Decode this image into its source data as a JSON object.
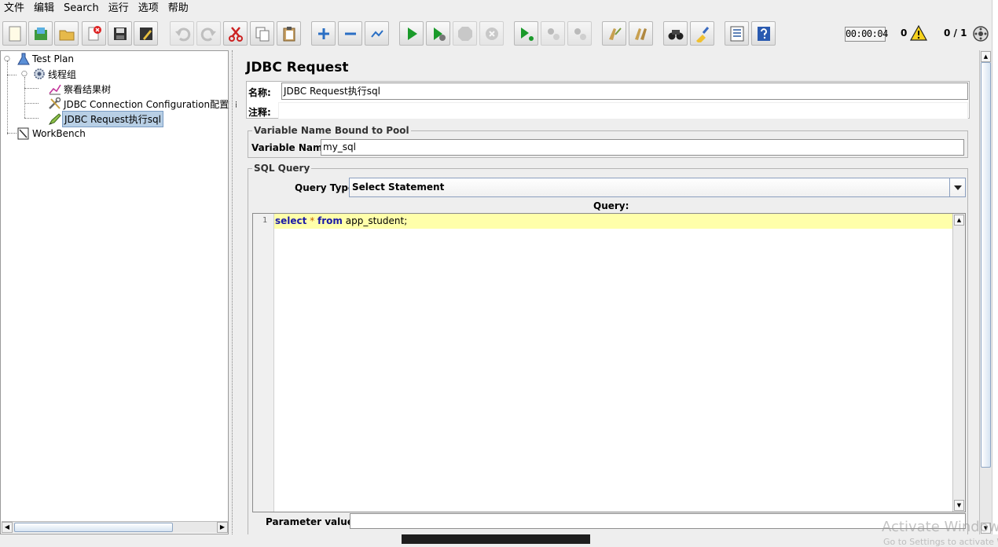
{
  "menu": [
    "文件",
    "编辑",
    "Search",
    "运行",
    "选项",
    "帮助"
  ],
  "toolbar": {
    "icons": [
      "new-icon",
      "templates-icon",
      "open-icon",
      "close-icon",
      "save-icon",
      "save-as-icon",
      "undo-icon",
      "redo-icon",
      "cut-icon",
      "copy-icon",
      "paste-icon",
      "expand-icon",
      "collapse-icon",
      "toggle-icon",
      "start-icon",
      "start-no-pause-icon",
      "stop-icon",
      "shutdown-icon",
      "remote-start-icon",
      "remote-stop-icon",
      "remote-shutdown-icon",
      "clear-icon",
      "clear-all-icon",
      "search-icon",
      "reset-search-icon",
      "function-helper-icon",
      "help-icon"
    ],
    "timer": "00:00:04",
    "warning_count": "0",
    "threads": "0 / 1"
  },
  "tree": {
    "test_plan": "Test Plan",
    "thread_group": "线程组",
    "listener": "察看结果树",
    "jdbc_config": "JDBC Connection Configuration配置数",
    "jdbc_request": "JDBC Request执行sql",
    "workbench": "WorkBench"
  },
  "panel": {
    "title": "JDBC Request",
    "name_label": "名称:",
    "name_value": "JDBC Request执行sql",
    "comment_label": "注释:",
    "comment_value": "",
    "pool_group_title": "Variable Name Bound to Pool",
    "var_name_label": "Variable Name:",
    "var_name_value": "my_sql",
    "sql_group_title": "SQL Query",
    "query_type_label": "Query Type:",
    "query_type_value": "Select Statement",
    "query_label": "Query:",
    "line_number": "1",
    "code_kw1": "select",
    "code_op": "*",
    "code_kw2": "from",
    "code_rest": "app_student;",
    "param_label": "Parameter values:"
  },
  "watermark": {
    "line1": "Activate Windows",
    "line2": "Go to Settings to activate Windows."
  }
}
